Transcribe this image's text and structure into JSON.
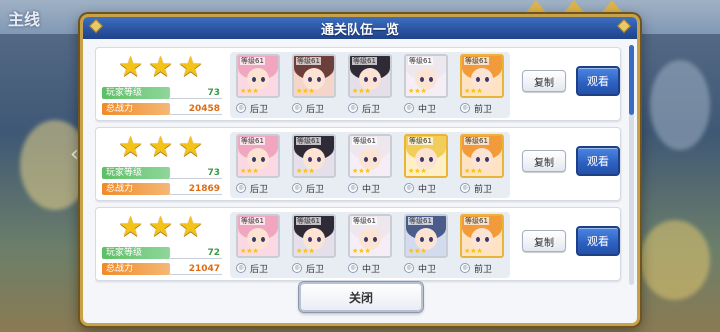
{
  "background": {
    "top_left_text": "主线"
  },
  "modal": {
    "title": "通关队伍一览",
    "close_label": "关闭",
    "copy_label": "复制",
    "view_label": "观看",
    "player_level_label": "玩家等级",
    "power_label": "总战力",
    "level_tag": "等级61",
    "teams": [
      {
        "stars": 3,
        "player_level": "73",
        "power": "20458",
        "members": [
          {
            "position": "后卫",
            "hair": "#f1a6bf",
            "bg": "#fbd9e4",
            "gold": false
          },
          {
            "position": "后卫",
            "hair": "#6d3f3a",
            "bg": "#f3d5c9",
            "gold": false
          },
          {
            "position": "后卫",
            "hair": "#2f2b36",
            "bg": "#e5dfe9",
            "gold": false
          },
          {
            "position": "中卫",
            "hair": "#eee7ee",
            "bg": "#f6eef6",
            "gold": false
          },
          {
            "position": "前卫",
            "hair": "#f19b3a",
            "bg": "#fde2c4",
            "gold": true
          }
        ]
      },
      {
        "stars": 3,
        "player_level": "73",
        "power": "21869",
        "members": [
          {
            "position": "后卫",
            "hair": "#f1a6bf",
            "bg": "#fbd9e4",
            "gold": false
          },
          {
            "position": "后卫",
            "hair": "#2f2b36",
            "bg": "#e5dfe9",
            "gold": false
          },
          {
            "position": "中卫",
            "hair": "#eee7ee",
            "bg": "#f6eef6",
            "gold": false
          },
          {
            "position": "中卫",
            "hair": "#f3cd5a",
            "bg": "#fdf0c7",
            "gold": true
          },
          {
            "position": "前卫",
            "hair": "#f19b3a",
            "bg": "#fde2c4",
            "gold": true
          }
        ]
      },
      {
        "stars": 3,
        "player_level": "72",
        "power": "21047",
        "members": [
          {
            "position": "后卫",
            "hair": "#f1a6bf",
            "bg": "#fbd9e4",
            "gold": false
          },
          {
            "position": "后卫",
            "hair": "#2f2b36",
            "bg": "#e5dfe9",
            "gold": false
          },
          {
            "position": "中卫",
            "hair": "#eee7ee",
            "bg": "#f6eef6",
            "gold": false
          },
          {
            "position": "中卫",
            "hair": "#4a5c8c",
            "bg": "#d3dbef",
            "gold": false
          },
          {
            "position": "前卫",
            "hair": "#f19b3a",
            "bg": "#fde2c4",
            "gold": true
          }
        ]
      }
    ]
  },
  "colors": {
    "header_blue": "#2a54a3",
    "view_button_blue": "#2b5fc1",
    "level_green": "#5bbf63",
    "power_orange": "#ef8a2a",
    "star_gold": "#f5c21a"
  }
}
